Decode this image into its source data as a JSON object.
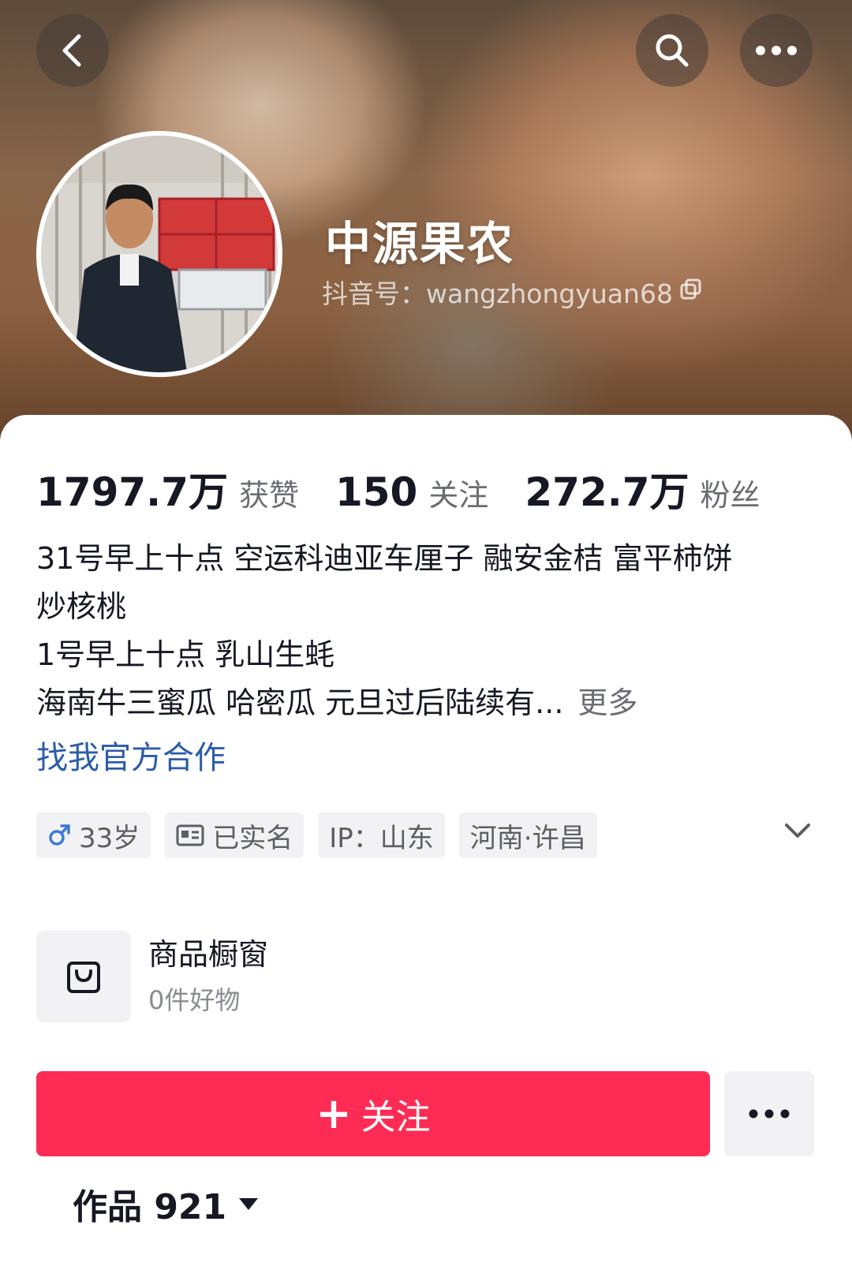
{
  "header": {
    "nickname": "中源果农",
    "douyin_id": "抖音号：wangzhongyuan68",
    "icons": {
      "back": "chevron-left-icon",
      "search": "search-icon",
      "more": "more-horizontal-icon",
      "copy": "copy-icon"
    }
  },
  "stats": [
    {
      "value": "1797.7万",
      "label": "获赞"
    },
    {
      "value": "150",
      "label": "关注"
    },
    {
      "value": "272.7万",
      "label": "粉丝"
    }
  ],
  "bio": {
    "lines": [
      "31号早上十点 空运科迪亚车厘子 融安金桔 富平柿饼",
      "炒核桃",
      "1号早上十点 乳山生蚝",
      "海南牛三蜜瓜 哈密瓜 元旦过后陆续有..."
    ],
    "more_label": "更多",
    "cooperate_link": "找我官方合作"
  },
  "tags": [
    {
      "icon": "male-icon",
      "label": "33岁"
    },
    {
      "icon": "id-card-icon",
      "label": "已实名"
    },
    {
      "icon": "",
      "label": "IP：山东"
    },
    {
      "icon": "",
      "label": "河南·许昌"
    }
  ],
  "shop": {
    "title": "商品橱窗",
    "subtitle": "0件好物",
    "icon": "shopping-bag-icon"
  },
  "actions": {
    "follow_label": "关注",
    "follow_plus": "+",
    "more_icon": "more-horizontal-icon"
  },
  "works": {
    "label": "作品 921"
  },
  "colors": {
    "accent": "#fe2c55",
    "link": "#2b5ca8",
    "male": "#3a7bd5",
    "text": "#161823",
    "secondary": "#6b6d74"
  }
}
